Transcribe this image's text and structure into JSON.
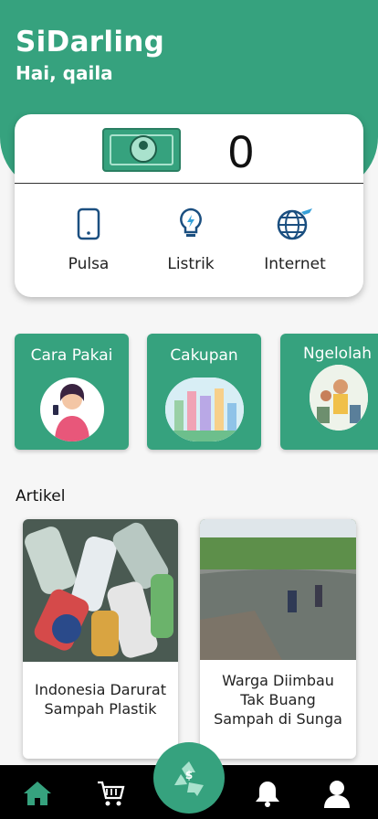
{
  "app": {
    "title": "SiDarling",
    "greeting": "Hai, qaila"
  },
  "balance": {
    "value": "0",
    "icon": "money-bill-icon"
  },
  "services": [
    {
      "label": "Pulsa",
      "icon": "phone-icon"
    },
    {
      "label": "Listrik",
      "icon": "lightbulb-icon"
    },
    {
      "label": "Internet",
      "icon": "globe-plane-icon"
    }
  ],
  "categories": [
    {
      "label": "Cara Pakai"
    },
    {
      "label": "Cakupan"
    },
    {
      "label": "Ngelolah"
    }
  ],
  "articles_section": {
    "title": "Artikel"
  },
  "articles": [
    {
      "title": "Indonesia Darurat Sampah Plastik"
    },
    {
      "title": "Warga Diimbau Tak Buang Sampah di Sunga"
    }
  ],
  "nav": {
    "items": [
      "home-icon",
      "cart-icon",
      "recycle-icon",
      "bell-icon",
      "user-icon"
    ],
    "fab_symbol": "$",
    "colors": {
      "accent": "#36a27e",
      "nav_bg": "#000000"
    }
  }
}
